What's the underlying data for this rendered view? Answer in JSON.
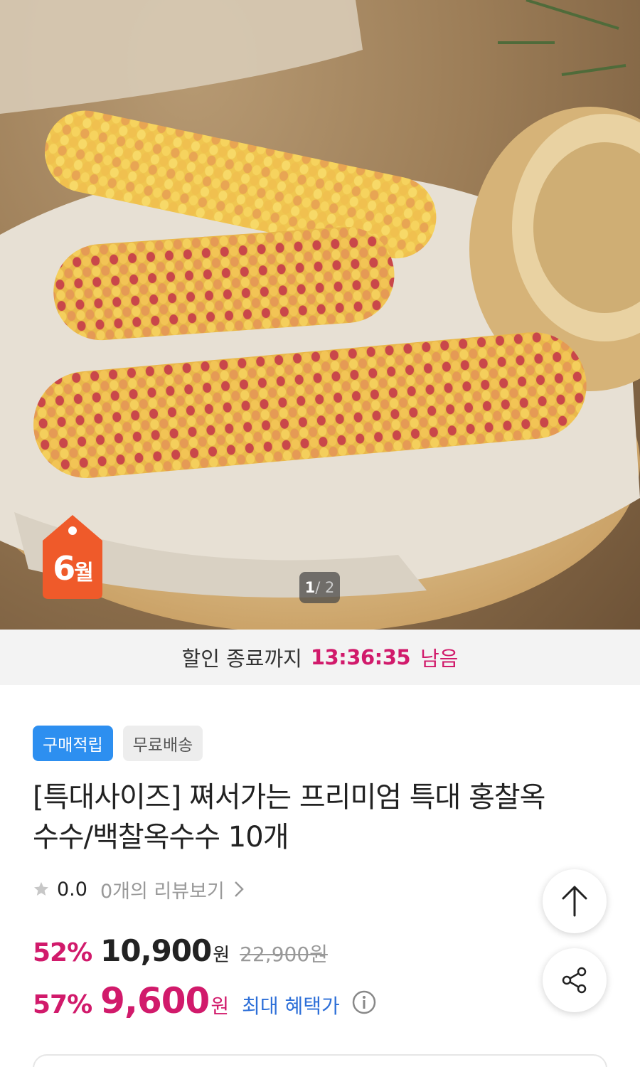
{
  "hero": {
    "month_badge": {
      "number": "6",
      "unit": "월"
    },
    "pager": {
      "current": "1",
      "total": "/ 2"
    }
  },
  "countdown": {
    "label": "할인 종료까지",
    "time": "13:36:35",
    "suffix": "남음"
  },
  "badges": [
    {
      "label": "구매적립",
      "color": "#2d8ff0"
    },
    {
      "label": "무료배송",
      "color": "#ededed"
    }
  ],
  "product": {
    "title_line1": "[특대사이즈] 쪄서가는 프리미엄 특대 홍찰옥",
    "title_line2": "수수/백찰옥수수 10개"
  },
  "rating": {
    "score": "0.0",
    "reviews": "0개의 리뷰보기"
  },
  "prices": {
    "discount_pct": "52%",
    "price": "10,900",
    "currency": "원",
    "original_price": "22,900원",
    "max_discount_pct": "57%",
    "max_price": "9,600",
    "max_label": "최대 혜택가"
  },
  "colors": {
    "accent": "#d11a6b",
    "blue": "#2d8ff0",
    "link": "#2d6fd8"
  },
  "icons": [
    "star-icon",
    "chevron-right-icon",
    "info-icon",
    "arrow-up-icon",
    "share-icon"
  ]
}
